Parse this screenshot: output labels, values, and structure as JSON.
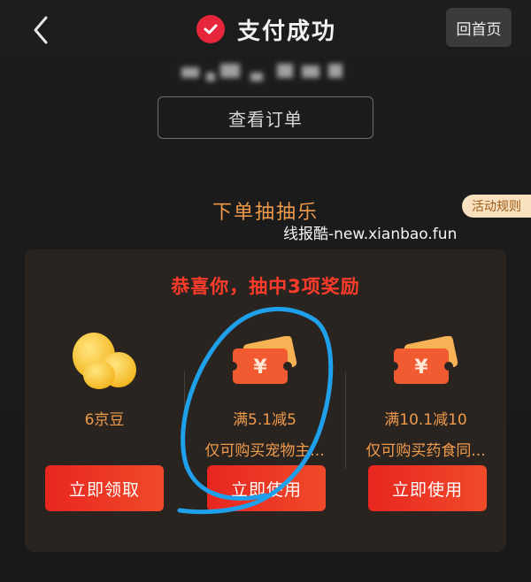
{
  "header": {
    "status_text": "支付成功",
    "home_label": "回首页"
  },
  "order": {
    "view_order_label": "查看订单"
  },
  "lottery": {
    "title": "下单抽抽乐",
    "rules_label": "活动规则",
    "watermark": "线报酷-new.xianbao.fun",
    "headline": "恭喜你，抽中3项奖励"
  },
  "prizes": [
    {
      "icon": "jingdou-icon",
      "line1": "6京豆",
      "line2": "",
      "button": "立即领取"
    },
    {
      "icon": "coupon-icon",
      "line1": "满5.1减5",
      "line2": "仅可购买宠物主...",
      "button": "立即使用"
    },
    {
      "icon": "coupon-icon",
      "line1": "满10.1减10",
      "line2": "仅可购买药食同...",
      "button": "立即使用"
    }
  ],
  "colors": {
    "background": "#1b1b1b",
    "accent_red": "#e6263b",
    "accent_orange": "#ef9a4b",
    "annotation_blue": "#1fa0ea"
  }
}
